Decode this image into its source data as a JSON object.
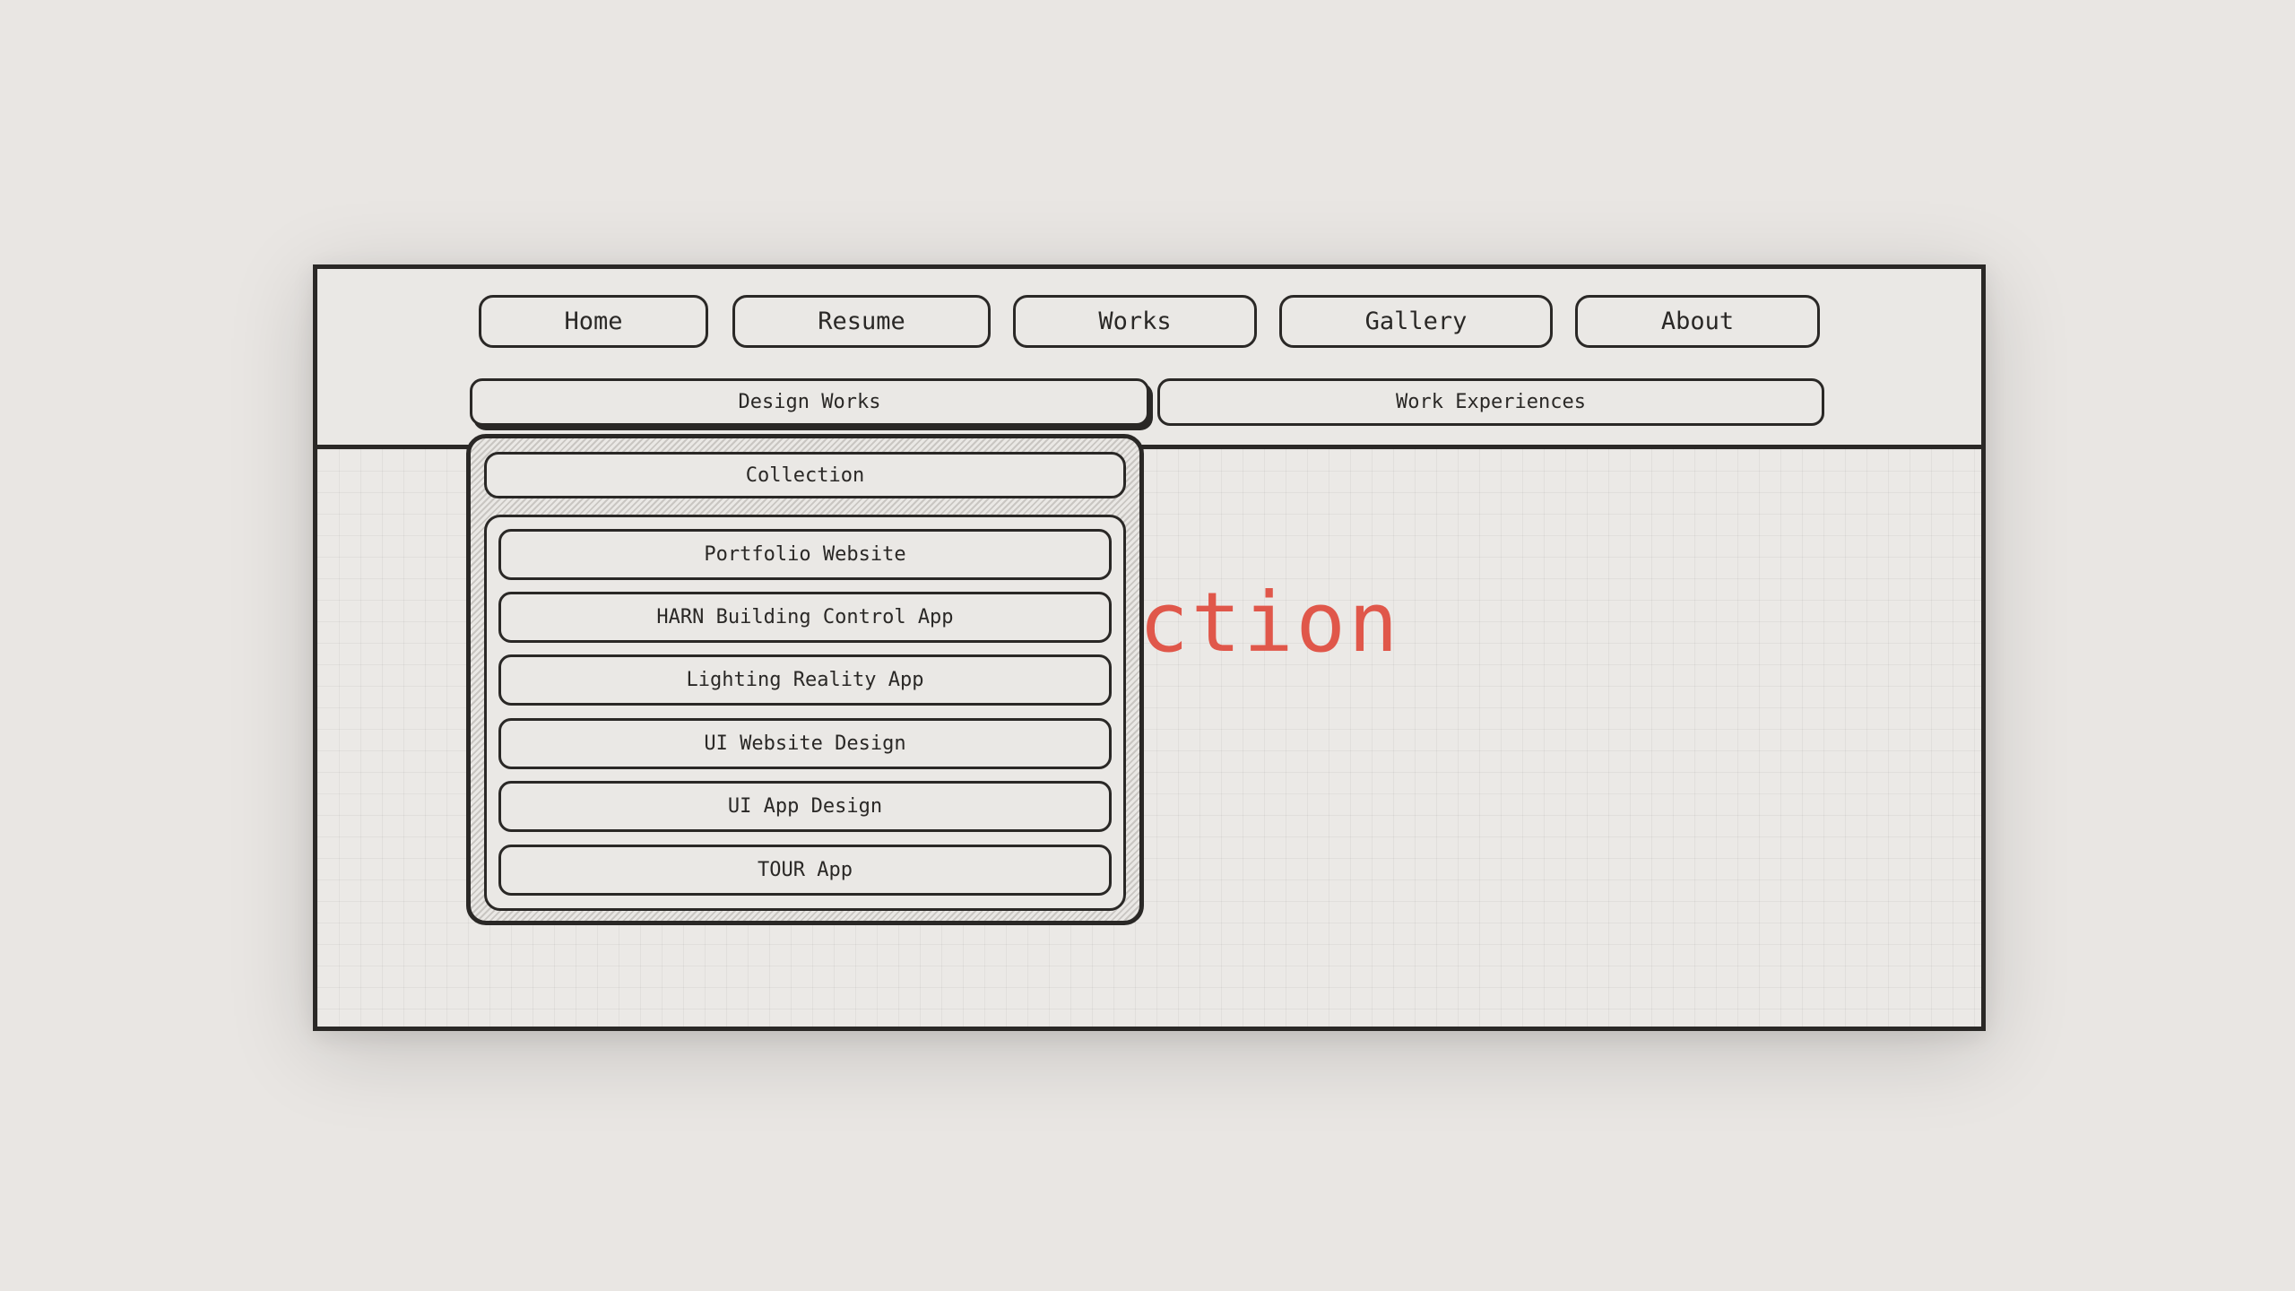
{
  "nav": {
    "items": [
      {
        "label": "Home"
      },
      {
        "label": "Resume"
      },
      {
        "label": "Works"
      },
      {
        "label": "Gallery"
      },
      {
        "label": "About"
      }
    ]
  },
  "subnav": {
    "items": [
      {
        "label": "Design Works",
        "active": true
      },
      {
        "label": "Work Experiences",
        "active": false
      }
    ]
  },
  "content": {
    "title_visible": "ection"
  },
  "dropdown": {
    "collection_label": "Collection",
    "items": [
      {
        "label": "Portfolio Website"
      },
      {
        "label": "HARN Building Control App"
      },
      {
        "label": "Lighting Reality App"
      },
      {
        "label": "UI Website Design"
      },
      {
        "label": "UI App Design"
      },
      {
        "label": "TOUR App"
      }
    ]
  },
  "colors": {
    "background": "#e9e6e3",
    "ink": "#2a2826",
    "accent": "#e0574a"
  }
}
